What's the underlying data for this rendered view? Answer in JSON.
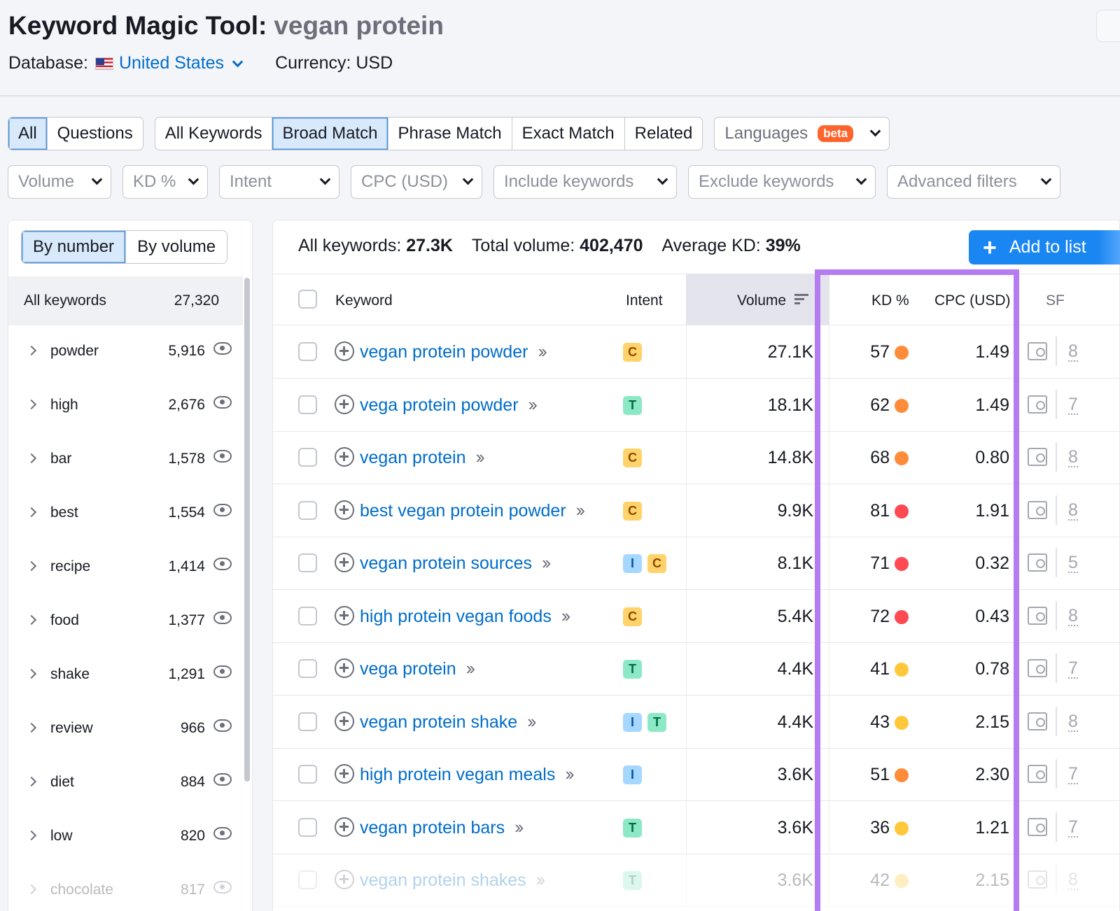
{
  "header": {
    "title": "Keyword Magic Tool:",
    "query": "vegan protein",
    "database_label": "Database:",
    "database_value": "United States",
    "currency": "Currency: USD"
  },
  "tabs": {
    "type_group": [
      {
        "label": "All",
        "active": true
      },
      {
        "label": "Questions",
        "active": false
      }
    ],
    "match_group": [
      {
        "label": "All Keywords",
        "active": false
      },
      {
        "label": "Broad Match",
        "active": true
      },
      {
        "label": "Phrase Match",
        "active": false
      },
      {
        "label": "Exact Match",
        "active": false
      },
      {
        "label": "Related",
        "active": false
      }
    ],
    "languages_label": "Languages",
    "languages_badge": "beta"
  },
  "filters": [
    "Volume",
    "KD %",
    "Intent",
    "CPC (USD)",
    "Include keywords",
    "Exclude keywords",
    "Advanced filters"
  ],
  "sidebar": {
    "toggle_by_number": "By number",
    "toggle_by_volume": "By volume",
    "all_keywords_label": "All keywords",
    "all_keywords_count": "27,320",
    "groups": [
      {
        "name": "powder",
        "count": "5,916"
      },
      {
        "name": "high",
        "count": "2,676"
      },
      {
        "name": "bar",
        "count": "1,578"
      },
      {
        "name": "best",
        "count": "1,554"
      },
      {
        "name": "recipe",
        "count": "1,414"
      },
      {
        "name": "food",
        "count": "1,377"
      },
      {
        "name": "shake",
        "count": "1,291"
      },
      {
        "name": "review",
        "count": "966"
      },
      {
        "name": "diet",
        "count": "884"
      },
      {
        "name": "low",
        "count": "820"
      },
      {
        "name": "chocolate",
        "count": "817"
      }
    ]
  },
  "summary": {
    "all_keywords_label": "All keywords:",
    "all_keywords_value": "27.3K",
    "total_volume_label": "Total volume:",
    "total_volume_value": "402,470",
    "avg_kd_label": "Average KD:",
    "avg_kd_value": "39%",
    "add_to_list": "Add to list"
  },
  "table": {
    "headers": {
      "keyword": "Keyword",
      "intent": "Intent",
      "volume": "Volume",
      "kd": "KD %",
      "cpc": "CPC (USD)",
      "sf": "SF"
    },
    "rows": [
      {
        "keyword": "vegan protein powder",
        "intent": [
          "C"
        ],
        "volume": "27.1K",
        "kd": "57",
        "kd_color": "#ff8c3a",
        "cpc": "1.49",
        "sf": "8"
      },
      {
        "keyword": "vega protein powder",
        "intent": [
          "T"
        ],
        "volume": "18.1K",
        "kd": "62",
        "kd_color": "#ff8c3a",
        "cpc": "1.49",
        "sf": "7"
      },
      {
        "keyword": "vegan protein",
        "intent": [
          "C"
        ],
        "volume": "14.8K",
        "kd": "68",
        "kd_color": "#ff8c3a",
        "cpc": "0.80",
        "sf": "8"
      },
      {
        "keyword": "best vegan protein powder",
        "intent": [
          "C"
        ],
        "volume": "9.9K",
        "kd": "81",
        "kd_color": "#ff4953",
        "cpc": "1.91",
        "sf": "8"
      },
      {
        "keyword": "vegan protein sources",
        "intent": [
          "I",
          "C"
        ],
        "volume": "8.1K",
        "kd": "71",
        "kd_color": "#ff4953",
        "cpc": "0.32",
        "sf": "5"
      },
      {
        "keyword": "high protein vegan foods",
        "intent": [
          "C"
        ],
        "volume": "5.4K",
        "kd": "72",
        "kd_color": "#ff4953",
        "cpc": "0.43",
        "sf": "8"
      },
      {
        "keyword": "vega protein",
        "intent": [
          "T"
        ],
        "volume": "4.4K",
        "kd": "41",
        "kd_color": "#ffc83a",
        "cpc": "0.78",
        "sf": "7"
      },
      {
        "keyword": "vegan protein shake",
        "intent": [
          "I",
          "T"
        ],
        "volume": "4.4K",
        "kd": "43",
        "kd_color": "#ffc83a",
        "cpc": "2.15",
        "sf": "8"
      },
      {
        "keyword": "high protein vegan meals",
        "intent": [
          "I"
        ],
        "volume": "3.6K",
        "kd": "51",
        "kd_color": "#ff8c3a",
        "cpc": "2.30",
        "sf": "7"
      },
      {
        "keyword": "vegan protein bars",
        "intent": [
          "T"
        ],
        "volume": "3.6K",
        "kd": "36",
        "kd_color": "#ffc83a",
        "cpc": "1.21",
        "sf": "7"
      },
      {
        "keyword": "vegan protein shakes",
        "intent": [
          "T"
        ],
        "volume": "3.6K",
        "kd": "42",
        "kd_color": "#ffc83a",
        "cpc": "2.15",
        "sf": "8",
        "faded": true
      }
    ]
  },
  "colors": {
    "accent": "#006dca",
    "button": "#1a86f2",
    "highlight": "#b57cf2",
    "beta": "#ff642d"
  }
}
